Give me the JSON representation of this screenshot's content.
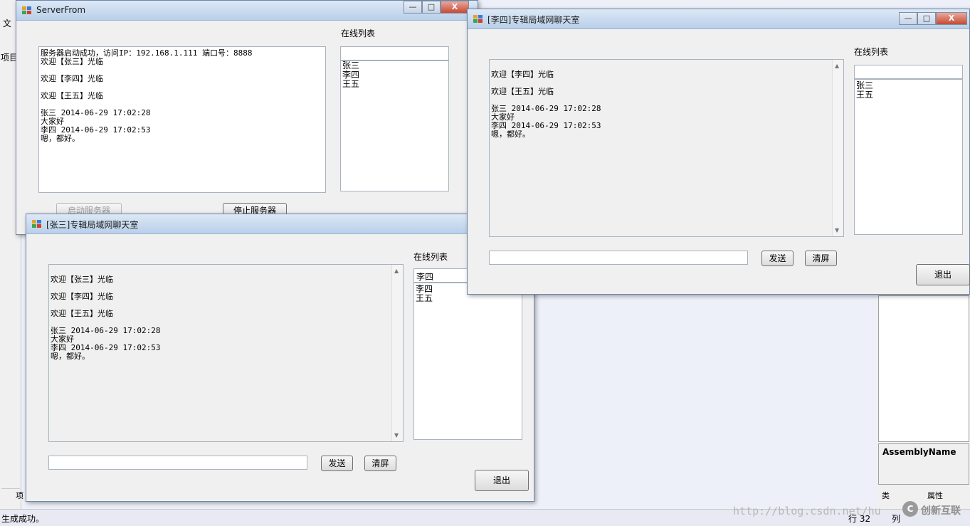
{
  "ide": {
    "left_menu": "文",
    "left_project": "项目",
    "bottom_tab": "项",
    "status_text": "生成成功。",
    "row_label": "行 32",
    "col_label": "列",
    "assembly_label": "AssemblyName",
    "bottom_right_tab1": "类",
    "bottom_right_tab2": "属性",
    "watermark_url": "http://blog.csdn.net/hu",
    "watermark_brand": "创新互联"
  },
  "server": {
    "title": "ServerFrom",
    "online_label": "在线列表",
    "log_lines": [
      "服务器启动成功，访问IP：192.168.1.111  端口号：8888",
      "欢迎【张三】光临",
      "欢迎【李四】光临",
      "欢迎【王五】光临",
      "张三    2014-06-29 17:02:28",
      "  大家好",
      "李四    2014-06-29 17:02:53",
      "  嗯，都好。"
    ],
    "online_users": [
      "张三",
      "李四",
      "王五"
    ],
    "start_button": "启动服务器",
    "stop_button": "停止服务器",
    "min": "—",
    "max": "□",
    "close": "X"
  },
  "lisi": {
    "title": "[李四]专辑局域网聊天室",
    "online_label": "在线列表",
    "messages": [
      "欢迎【李四】光临",
      "欢迎【王五】光临",
      "张三    2014-06-29 17:02:28",
      "  大家好",
      "李四    2014-06-29 17:02:53",
      "  嗯，都好。"
    ],
    "search_value": "",
    "online_users": [
      "张三",
      "王五"
    ],
    "input_value": "",
    "send_button": "发送",
    "clear_button": "清屏",
    "exit_button": "退出",
    "min": "—",
    "max": "□",
    "close": "X"
  },
  "zhangsan": {
    "title": "[张三]专辑局域网聊天室",
    "online_label": "在线列表",
    "messages": [
      "欢迎【张三】光临",
      "欢迎【李四】光临",
      "欢迎【王五】光临",
      "张三    2014-06-29 17:02:28",
      "  大家好",
      "李四    2014-06-29 17:02:53",
      "  嗯，都好。"
    ],
    "search_value": "李四",
    "online_users": [
      "李四",
      "王五"
    ],
    "input_value": "",
    "send_button": "发送",
    "clear_button": "清屏",
    "exit_button": "退出"
  },
  "colors": {
    "title_bar": "#c9daee",
    "close_red": "#c74a33",
    "panel": "#f0f0f0"
  }
}
